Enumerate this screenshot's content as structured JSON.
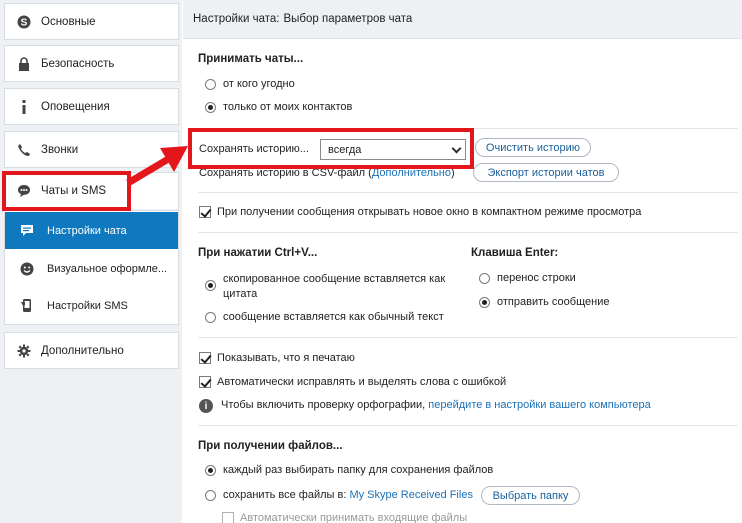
{
  "sidebar": {
    "items": [
      {
        "label": "Основные",
        "icon": "skype-icon"
      },
      {
        "label": "Безопасность",
        "icon": "lock-icon"
      },
      {
        "label": "Оповещения",
        "icon": "info-icon"
      },
      {
        "label": "Звонки",
        "icon": "phone-icon"
      },
      {
        "label": "Чаты и SMS",
        "icon": "chat-icon"
      }
    ],
    "sub_items": [
      {
        "label": "Настройки чата",
        "icon": "chat-bubble-icon",
        "active": true
      },
      {
        "label": "Визуальное оформле...",
        "icon": "smiley-icon",
        "active": false
      },
      {
        "label": "Настройки SMS",
        "icon": "sms-phone-icon",
        "active": false
      }
    ],
    "advanced": {
      "label": "Дополнительно",
      "icon": "gear-icon"
    }
  },
  "header": {
    "title": "Настройки чата:",
    "subtitle": "Выбор параметров чата"
  },
  "accept_chats": {
    "title": "Принимать чаты...",
    "options": [
      {
        "label": "от кого угодно",
        "selected": false
      },
      {
        "label": "только от моих контактов",
        "selected": true
      }
    ]
  },
  "history": {
    "save_label": "Сохранять историю...",
    "save_value": "всегда",
    "clear_button": "Очистить историю",
    "csv_label": "Сохранять историю в CSV-файл (",
    "csv_link": "Дополнительно",
    "csv_close": ")",
    "export_button": "Экспорт истории чатов"
  },
  "compact_mode": {
    "label": "При получении сообщения открывать новое окно в компактном режиме просмотра",
    "checked": true
  },
  "ctrl_v": {
    "title": "При нажатии Ctrl+V...",
    "options": [
      {
        "label": "скопированное сообщение вставляется как",
        "label2": "цитата",
        "selected": true
      },
      {
        "label": "сообщение вставляется как обычный текст",
        "selected": false
      }
    ]
  },
  "enter_key": {
    "title": "Клавиша Enter:",
    "options": [
      {
        "label": "перенос строки",
        "selected": false
      },
      {
        "label": "отправить сообщение",
        "selected": true
      }
    ]
  },
  "typing": {
    "label": "Показывать, что я печатаю",
    "checked": true
  },
  "autocorrect": {
    "label": "Автоматически исправлять и выделять слова с ошибкой",
    "checked": true
  },
  "spellcheck": {
    "text": "Чтобы включить проверку орфографии,",
    "link": "перейдите в настройки вашего компьютера"
  },
  "files": {
    "title": "При получении файлов...",
    "options": [
      {
        "label": "каждый раз выбирать папку для сохранения файлов",
        "selected": true
      },
      {
        "label": "сохранить все файлы в:",
        "folder": "My Skype Received Files",
        "selected": false
      }
    ],
    "choose_button": "Выбрать папку",
    "auto_accept": {
      "label": "Автоматически принимать входящие файлы",
      "checked": false
    }
  },
  "colors": {
    "accent": "#0f78be",
    "highlight": "#e3161c",
    "link": "#1b72b8"
  }
}
